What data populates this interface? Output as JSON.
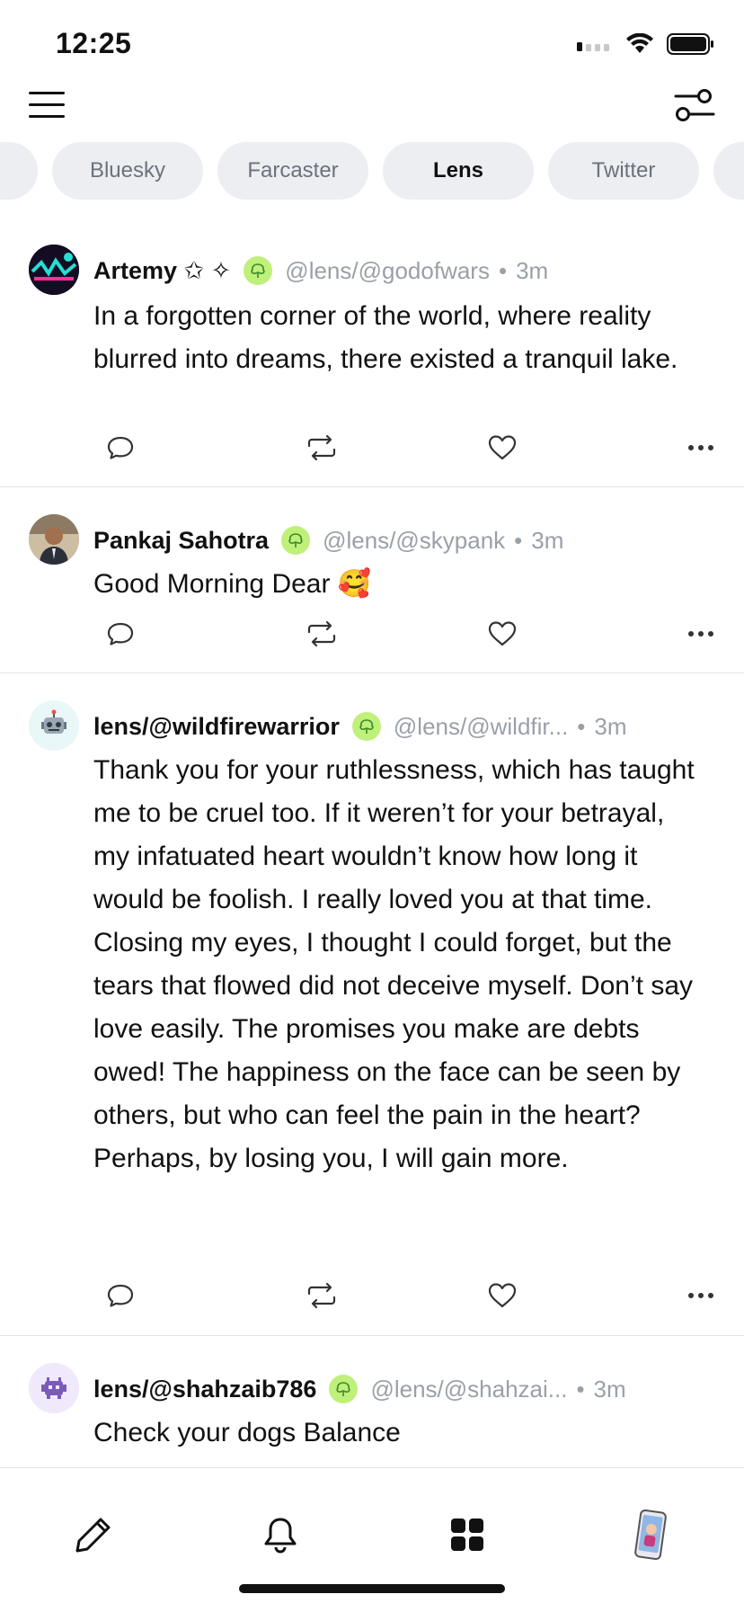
{
  "status_bar": {
    "time": "12:25"
  },
  "tabs": [
    {
      "label": "",
      "partial": true
    },
    {
      "label": "Bluesky"
    },
    {
      "label": "Farcaster"
    },
    {
      "label": "Lens",
      "active": true
    },
    {
      "label": "Twitter"
    },
    {
      "label": "",
      "partial": true
    }
  ],
  "posts": [
    {
      "author": "Artemy ✩ ✧",
      "handle": "@lens/@godofwars",
      "time": "3m",
      "text": "In a forgotten corner of the world, where reality blurred into dreams, there existed a tranquil lake.",
      "avatar_icon": "neon-art-avatar"
    },
    {
      "author": "Pankaj Sahotra",
      "handle": "@lens/@skypank",
      "time": "3m",
      "text": "Good Morning Dear 🥰",
      "avatar_icon": "person-photo-avatar"
    },
    {
      "author": "lens/@wildfirewarrior",
      "handle": "@lens/@wildfir...",
      "time": "3m",
      "text": "Thank you for your ruthlessness, which has taught me to be cruel too. If it weren’t for your betrayal, my infatuated heart wouldn’t know how long it would be foolish. I really loved you at that time. Closing my eyes, I thought I could forget, but the tears that flowed did not deceive myself. Don’t say love easily. The promises you make are debts owed! The happiness on the face can be seen by others, but who can feel the pain in the heart? Perhaps, by losing you, I will gain more.",
      "avatar_icon": "robot-avatar"
    },
    {
      "author": "lens/@shahzaib786",
      "handle": "@lens/@shahzai...",
      "time": "3m",
      "text": "Check your dogs Balance",
      "avatar_icon": "alien-avatar"
    }
  ],
  "separator": "•",
  "bottom_nav": [
    "compose-icon",
    "bell-icon",
    "grid-icon",
    "profile-avatar"
  ],
  "colors": {
    "badge": "#bff07a",
    "tab_bg": "#eceef1",
    "muted": "#9aa0a8"
  }
}
